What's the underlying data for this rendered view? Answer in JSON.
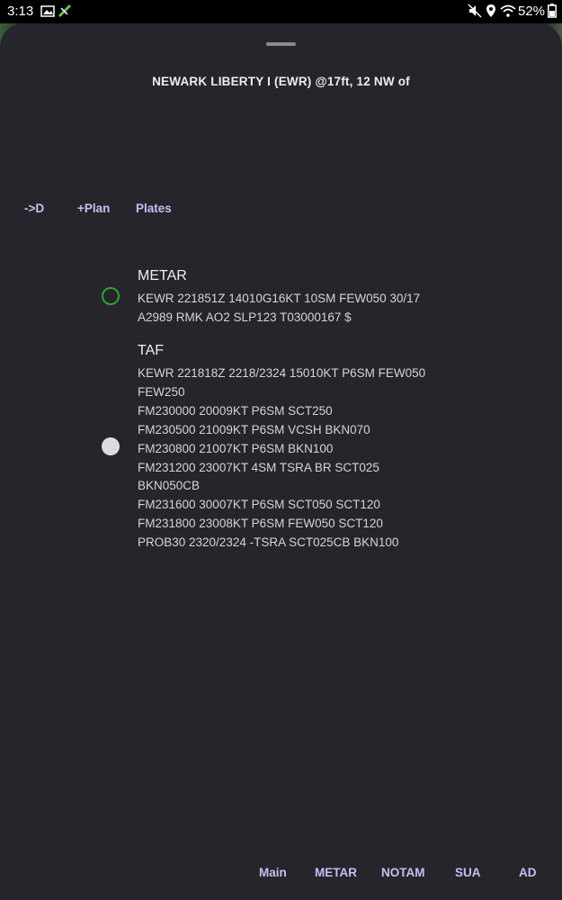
{
  "status_bar": {
    "time": "3:13",
    "battery": "52%",
    "left_icons": [
      "image-icon",
      "app-notification-icon"
    ],
    "right_icons": [
      "mute-icon",
      "location-icon",
      "wifi-icon",
      "battery-icon"
    ]
  },
  "sheet": {
    "title": "NEWARK LIBERTY I (EWR) @17ft, 12 NW of",
    "actions": {
      "direct_to": "->D",
      "add_plan": "+Plan",
      "plates": "Plates"
    }
  },
  "metar": {
    "heading": "METAR",
    "lines": [
      "KEWR 221851Z 14010G16KT 10SM FEW050 30/17",
      "A2989 RMK AO2 SLP123 T03000167 $"
    ],
    "status_color": "#2ea32e"
  },
  "taf": {
    "heading": "TAF",
    "lines": [
      "KEWR 221818Z 2218/2324 15010KT P6SM FEW050",
      "FEW250",
      "FM230000 20009KT P6SM SCT250",
      "FM230500 21009KT P6SM VCSH BKN070",
      "FM230800 21007KT P6SM BKN100",
      "FM231200 23007KT 4SM TSRA BR SCT025",
      "BKN050CB",
      "FM231600 30007KT P6SM SCT050 SCT120",
      "FM231800 23008KT P6SM FEW050 SCT120",
      "PROB30 2320/2324 -TSRA SCT025CB BKN100"
    ],
    "status_color": "#dcdcdf"
  },
  "bottom_tabs": {
    "main": "Main",
    "metar": "METAR",
    "notam": "NOTAM",
    "sua": "SUA",
    "ad": "AD"
  },
  "colors": {
    "sheet_background": "#26252b",
    "accent": "#c9bdf3",
    "text": "#d4d4d8"
  }
}
